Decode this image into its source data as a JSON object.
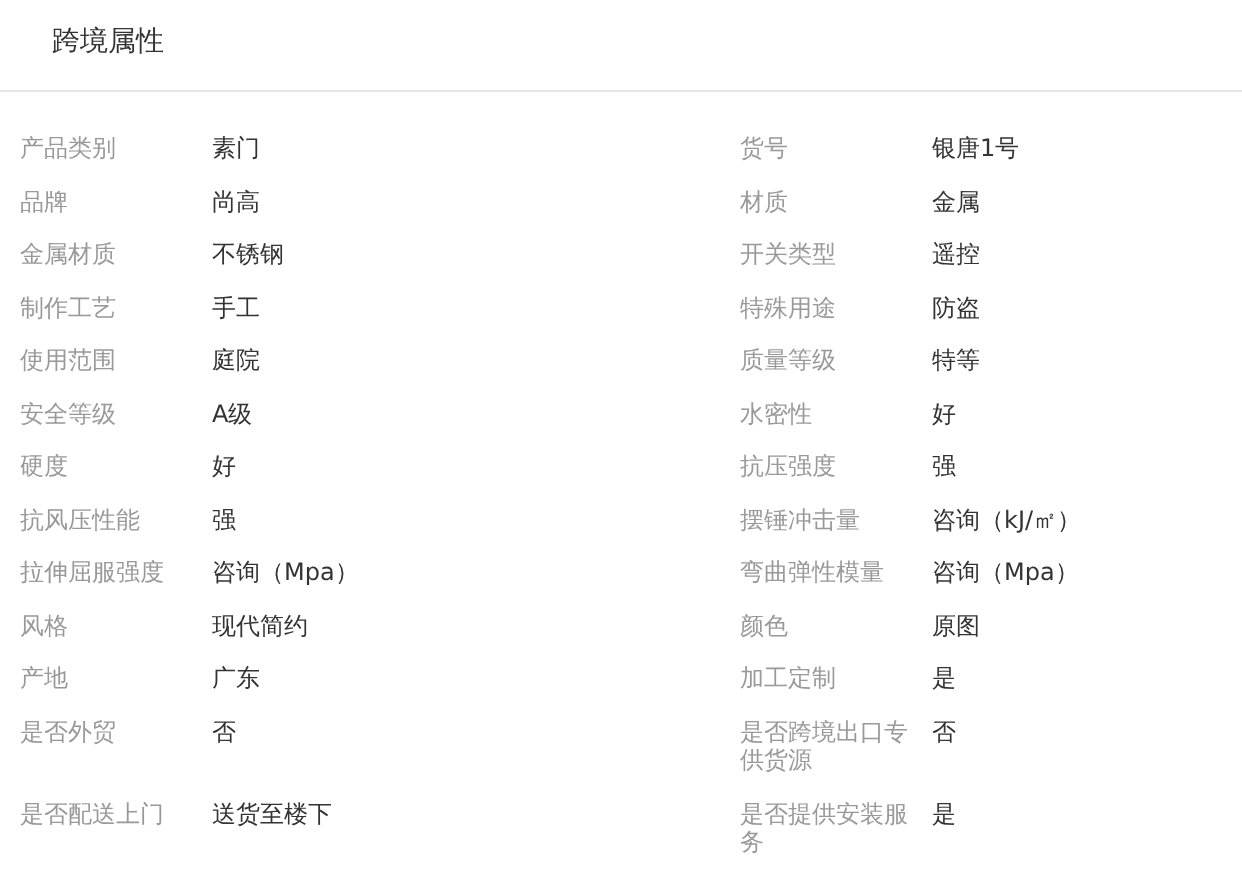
{
  "title": "跨境属性",
  "attributes": [
    {
      "label": "产品类别",
      "value": "素门"
    },
    {
      "label": "货号",
      "value": "银唐1号"
    },
    {
      "label": "品牌",
      "value": "尚高"
    },
    {
      "label": "材质",
      "value": "金属"
    },
    {
      "label": "金属材质",
      "value": "不锈钢"
    },
    {
      "label": "开关类型",
      "value": "遥控"
    },
    {
      "label": "制作工艺",
      "value": "手工"
    },
    {
      "label": "特殊用途",
      "value": "防盗"
    },
    {
      "label": "使用范围",
      "value": "庭院"
    },
    {
      "label": "质量等级",
      "value": "特等"
    },
    {
      "label": "安全等级",
      "value": "A级"
    },
    {
      "label": "水密性",
      "value": "好"
    },
    {
      "label": "硬度",
      "value": "好"
    },
    {
      "label": "抗压强度",
      "value": "强"
    },
    {
      "label": "抗风压性能",
      "value": "强"
    },
    {
      "label": "摆锤冲击量",
      "value": "咨询（kJ/㎡）"
    },
    {
      "label": "拉伸屈服强度",
      "value": "咨询（Mpa）"
    },
    {
      "label": "弯曲弹性模量",
      "value": "咨询（Mpa）"
    },
    {
      "label": "风格",
      "value": "现代简约"
    },
    {
      "label": "颜色",
      "value": "原图"
    },
    {
      "label": "产地",
      "value": "广东"
    },
    {
      "label": "加工定制",
      "value": "是"
    },
    {
      "label": "是否外贸",
      "value": "否"
    },
    {
      "label": "是否跨境出口专供货源",
      "value": "否"
    },
    {
      "label": "是否配送上门",
      "value": "送货至楼下"
    },
    {
      "label": "是否提供安装服务",
      "value": "是"
    }
  ]
}
